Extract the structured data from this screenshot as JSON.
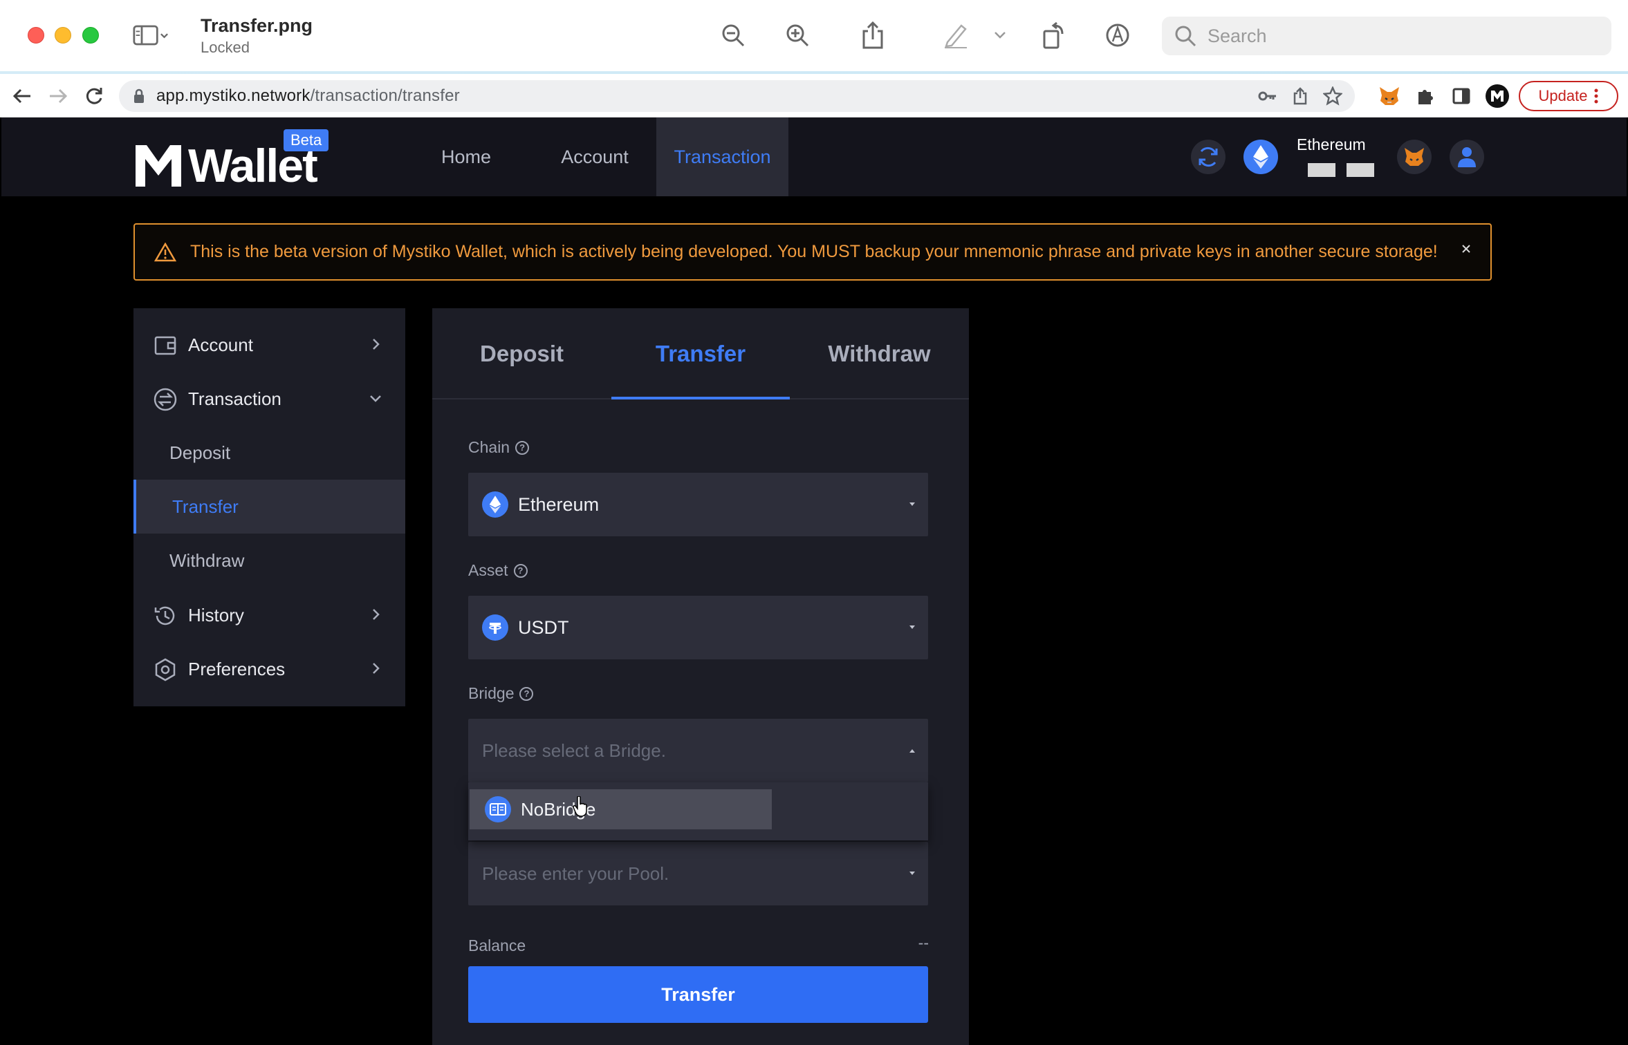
{
  "window": {
    "doc_title": "Transfer.png",
    "doc_status": "Locked",
    "search_placeholder": "Search"
  },
  "browser": {
    "url_host": "app.mystiko.network",
    "url_path": "/transaction/transfer",
    "update_label": "Update"
  },
  "header": {
    "logo_text": "Wallet",
    "badge": "Beta",
    "nav": [
      {
        "label": "Home"
      },
      {
        "label": "Account"
      },
      {
        "label": "Transaction"
      }
    ],
    "network_name": "Ethereum"
  },
  "alert": {
    "text": "This is the beta version of Mystiko Wallet, which is actively being developed. You MUST backup your mnemonic phrase and private keys in another secure storage!",
    "close": "×"
  },
  "sidebar": {
    "items": [
      {
        "label": "Account"
      },
      {
        "label": "Transaction"
      },
      {
        "label": "Deposit"
      },
      {
        "label": "Transfer"
      },
      {
        "label": "Withdraw"
      },
      {
        "label": "History"
      },
      {
        "label": "Preferences"
      }
    ]
  },
  "card": {
    "tabs": [
      {
        "label": "Deposit"
      },
      {
        "label": "Transfer"
      },
      {
        "label": "Withdraw"
      }
    ],
    "chain": {
      "label": "Chain",
      "value": "Ethereum"
    },
    "asset": {
      "label": "Asset",
      "value": "USDT"
    },
    "bridge": {
      "label": "Bridge",
      "placeholder": "Please select a Bridge.",
      "options": [
        {
          "label": "NoBridge"
        }
      ]
    },
    "pool": {
      "placeholder": "Please enter your Pool."
    },
    "balance": {
      "label": "Balance",
      "value": "--"
    },
    "submit_label": "Transfer"
  },
  "colors": {
    "accent": "#3f7cf5",
    "warning": "#f09a3e",
    "header_bg": "#14141c",
    "panel_bg": "#1c1d26"
  }
}
